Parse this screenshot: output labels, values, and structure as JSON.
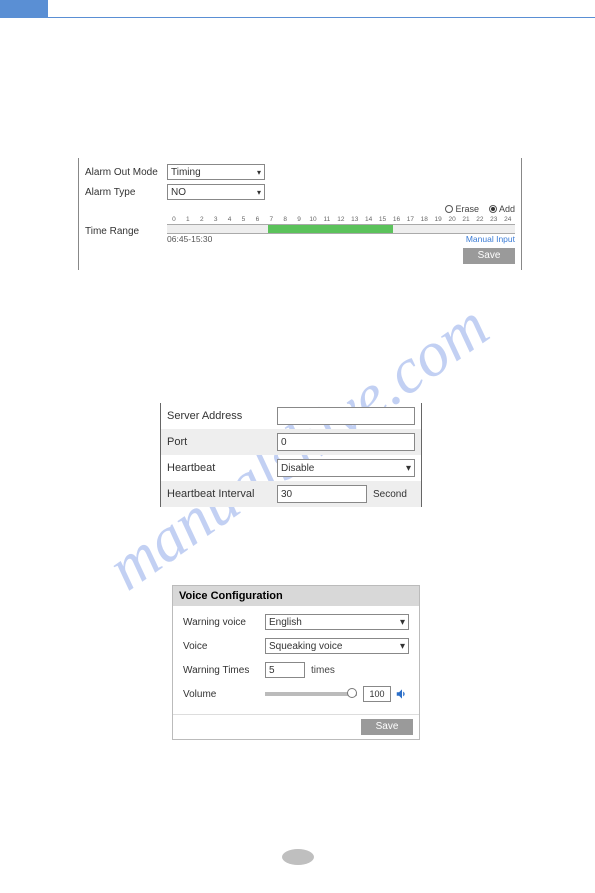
{
  "watermark": "manualshive.com",
  "alarm": {
    "out_mode_label": "Alarm Out Mode",
    "out_mode_value": "Timing",
    "type_label": "Alarm Type",
    "type_value": "NO",
    "erase_label": "Erase",
    "add_label": "Add",
    "time_range_label": "Time Range",
    "hours": [
      "0",
      "1",
      "2",
      "3",
      "4",
      "5",
      "6",
      "7",
      "8",
      "9",
      "10",
      "11",
      "12",
      "13",
      "14",
      "15",
      "16",
      "17",
      "18",
      "19",
      "20",
      "21",
      "22",
      "23",
      "24"
    ],
    "range_text": "06:45-15:30",
    "manual_input": "Manual Input",
    "save": "Save"
  },
  "server": {
    "address_label": "Server Address",
    "address_value": "",
    "port_label": "Port",
    "port_value": "0",
    "heartbeat_label": "Heartbeat",
    "heartbeat_value": "Disable",
    "interval_label": "Heartbeat Interval",
    "interval_value": "30",
    "interval_unit": "Second"
  },
  "voice": {
    "title": "Voice Configuration",
    "warning_voice_label": "Warning voice",
    "warning_voice_value": "English",
    "voice_label": "Voice",
    "voice_value": "Squeaking voice",
    "times_label": "Warning Times",
    "times_value": "5",
    "times_unit": "times",
    "volume_label": "Volume",
    "volume_value": "100",
    "save": "Save"
  }
}
